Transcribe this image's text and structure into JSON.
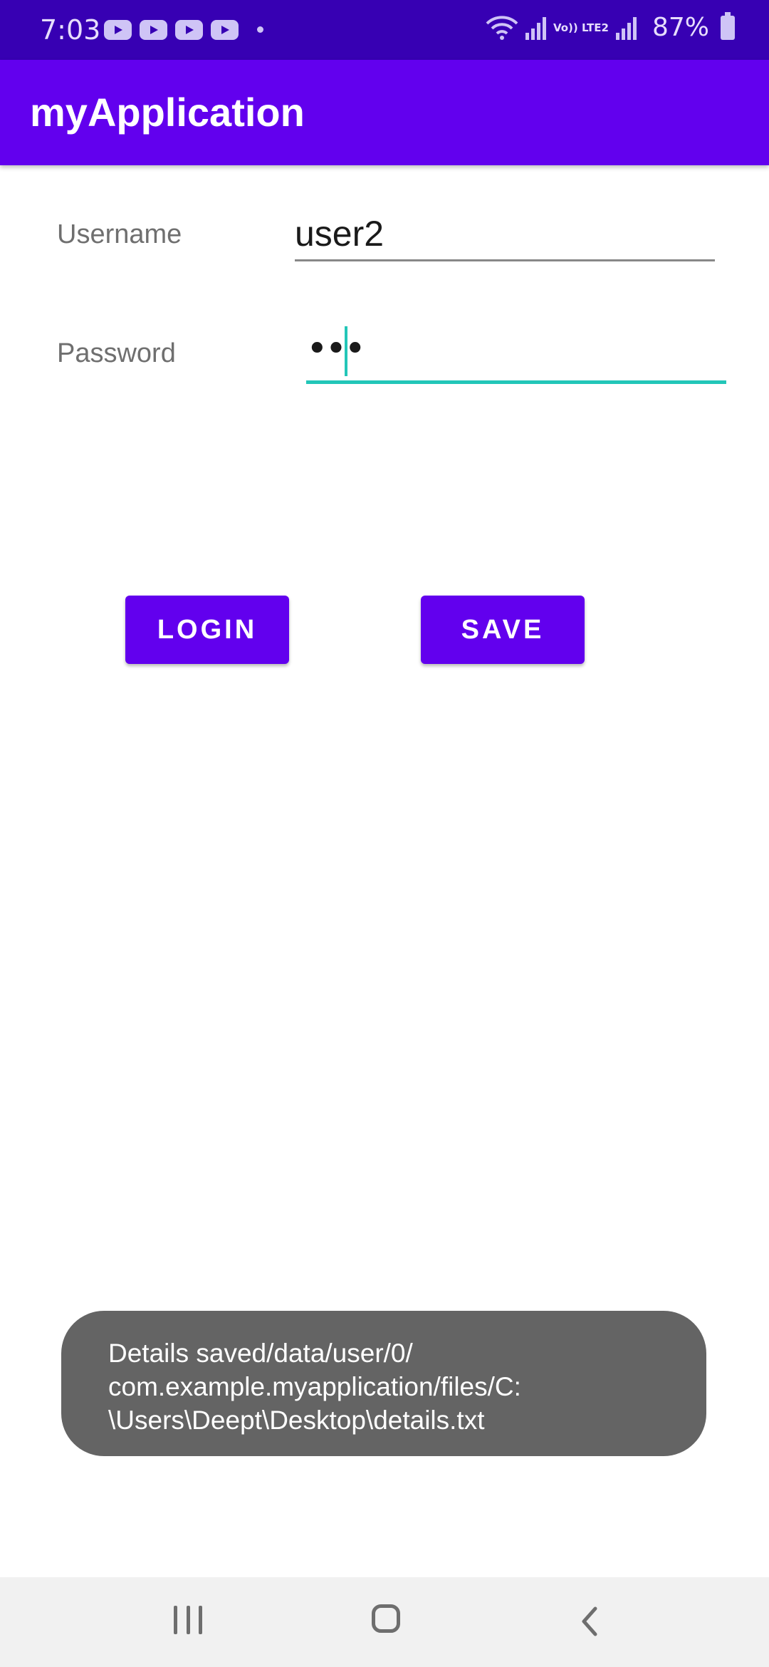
{
  "status_bar": {
    "time": "7:03",
    "notification_icons": [
      "youtube-icon",
      "youtube-icon",
      "youtube-icon",
      "youtube-icon"
    ],
    "lte_label": "Vo)) LTE2",
    "battery": "87%"
  },
  "app_bar": {
    "title": "myApplication"
  },
  "form": {
    "username_label": "Username",
    "username_value": "user2",
    "password_label": "Password",
    "password_value": "•••"
  },
  "buttons": {
    "login_label": "LOGIN",
    "save_label": "SAVE"
  },
  "toast": {
    "line1": "Details saved/data/user/0/",
    "line2": "com.example.myapplication/files/C:",
    "line3": "\\Users\\Deept\\Desktop\\details.txt"
  },
  "colors": {
    "status_bar": "#3700b3",
    "primary": "#6200ee",
    "accent": "#23c6b8",
    "toast_bg": "#646464"
  }
}
